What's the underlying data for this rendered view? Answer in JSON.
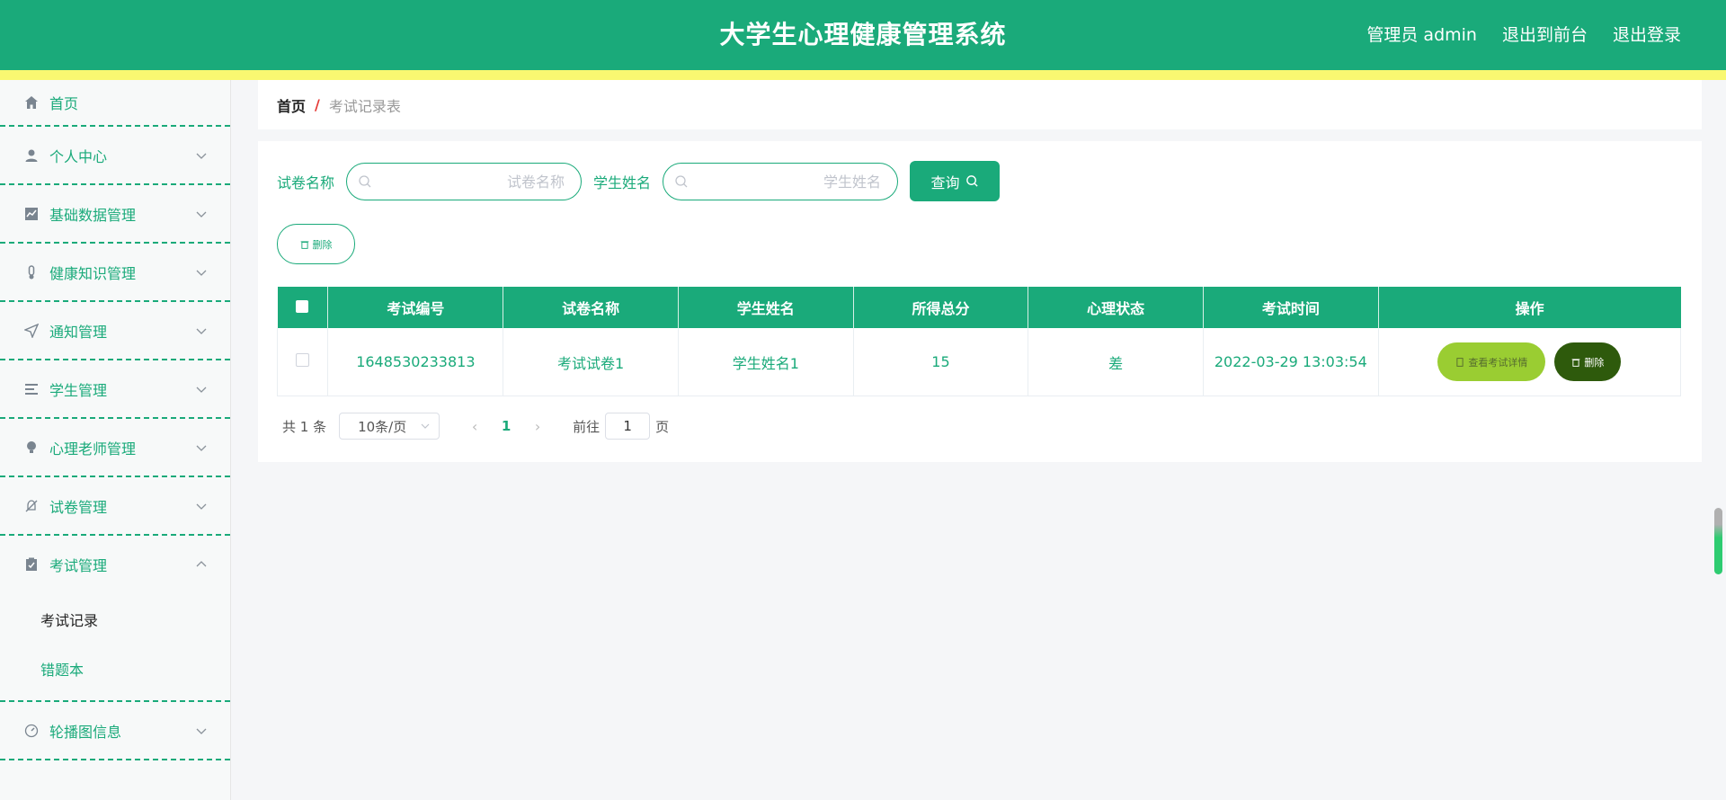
{
  "header": {
    "title": "大学生心理健康管理系统",
    "admin_label": "管理员 admin",
    "front_label": "退出到前台",
    "logout_label": "退出登录"
  },
  "sidebar": {
    "items": [
      {
        "label": "首页",
        "icon": "home-icon"
      },
      {
        "label": "个人中心",
        "icon": "user-icon"
      },
      {
        "label": "基础数据管理",
        "icon": "chart-icon"
      },
      {
        "label": "健康知识管理",
        "icon": "thermometer-icon"
      },
      {
        "label": "通知管理",
        "icon": "send-icon"
      },
      {
        "label": "学生管理",
        "icon": "list-icon"
      },
      {
        "label": "心理老师管理",
        "icon": "bulb-icon"
      },
      {
        "label": "试卷管理",
        "icon": "bell-off-icon"
      },
      {
        "label": "考试管理",
        "icon": "clipboard-icon"
      },
      {
        "label": "轮播图信息",
        "icon": "gauge-icon"
      }
    ],
    "sub_items": [
      "考试记录",
      "错题本"
    ]
  },
  "breadcrumb": {
    "home": "首页",
    "separator": "/",
    "current": "考试记录表"
  },
  "search": {
    "paper_label": "试卷名称",
    "paper_placeholder": "试卷名称",
    "student_label": "学生姓名",
    "student_placeholder": "学生姓名",
    "query_label": "查询"
  },
  "actions": {
    "delete_label": "删除"
  },
  "table": {
    "columns": [
      "考试编号",
      "试卷名称",
      "学生姓名",
      "所得总分",
      "心理状态",
      "考试时间",
      "操作"
    ],
    "rows": [
      {
        "exam_no": "1648530233813",
        "paper": "考试试卷1",
        "student": "学生姓名1",
        "score": "15",
        "status": "差",
        "time": "2022-03-29 13:03:54",
        "detail_label": "查看考试详情",
        "delete_label": "删除"
      }
    ]
  },
  "pagination": {
    "total_label": "共 1 条",
    "page_size": "10条/页",
    "current_page": "1",
    "goto_label": "前往",
    "goto_value": "1",
    "page_unit": "页"
  },
  "colors": {
    "primary": "#1aaa7a",
    "accent_bar": "#f9f871",
    "detail_btn": "#9acd32",
    "delete_btn": "#2e5a0c"
  }
}
